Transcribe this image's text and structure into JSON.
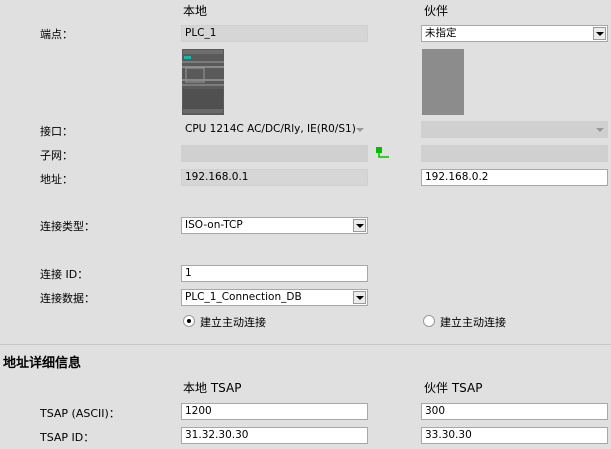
{
  "columns": {
    "local": "本地",
    "partner": "伙伴"
  },
  "labels": {
    "endpoint": "端点：",
    "interface": "接口：",
    "subnet": "子网：",
    "address": "地址：",
    "connection_type": "连接类型：",
    "connection_id": "连接 ID：",
    "connection_data": "连接数据："
  },
  "local": {
    "endpoint": "PLC_1",
    "interface": "CPU 1214C AC/DC/Rly, IE(R0/S1)",
    "subnet": "",
    "address": "192.168.0.1",
    "connection_type": "ISO-on-TCP",
    "connection_id": "1",
    "connection_data": "PLC_1_Connection_DB",
    "active_connection_label": "建立主动连接",
    "active_connection_selected": true
  },
  "partner": {
    "endpoint": "未指定",
    "interface": "",
    "subnet": "",
    "address": "192.168.0.2",
    "active_connection_label": "建立主动连接",
    "active_connection_selected": false
  },
  "address_details": {
    "title": "地址详细信息",
    "local_tsap_header": "本地 TSAP",
    "partner_tsap_header": "伙伴 TSAP",
    "tsap_ascii_label": "TSAP (ASCII)：",
    "tsap_id_label": "TSAP ID：",
    "local_tsap_ascii": "1200",
    "partner_tsap_ascii": "300",
    "local_tsap_id": "31.32.30.30",
    "partner_tsap_id": "33.30.30"
  },
  "colors": {
    "accent_green": "#00c000",
    "device_teal": "#1ab5a6"
  },
  "icons": {
    "network": "network-connection-icon",
    "local_device": "plc-device-icon",
    "partner_device": "unspecified-device-icon"
  }
}
